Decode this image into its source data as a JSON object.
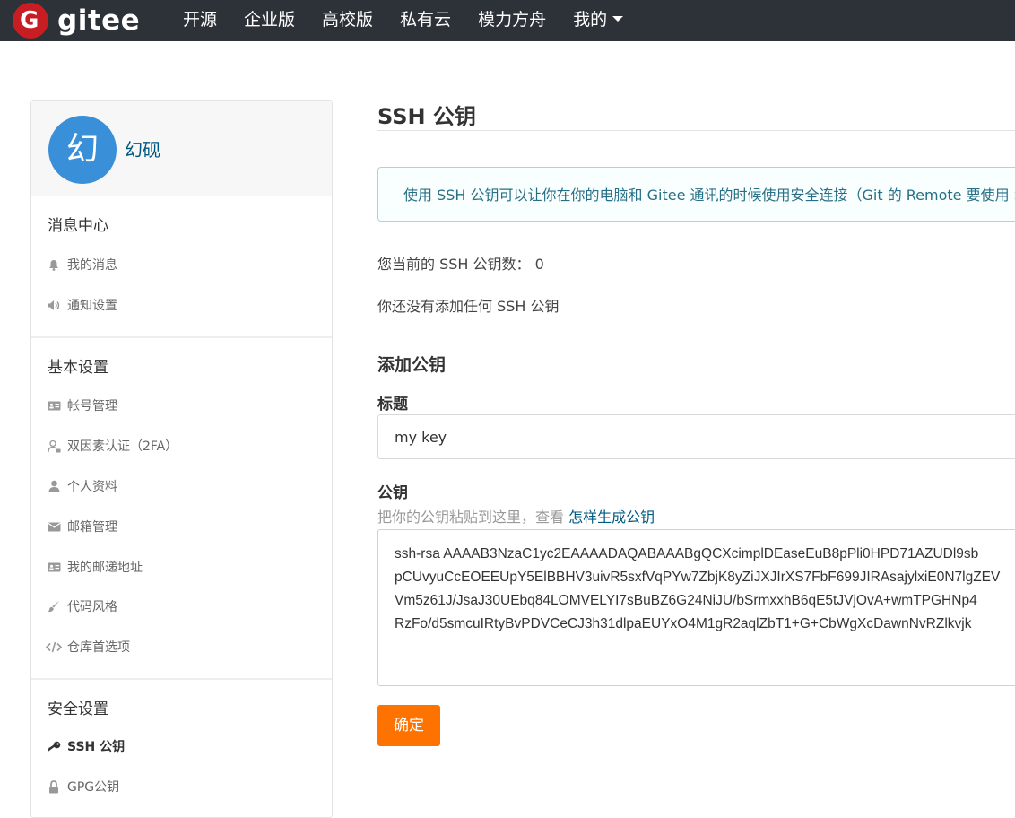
{
  "topbar": {
    "logo_letter": "G",
    "logo_text": "gitee",
    "nav": [
      "开源",
      "企业版",
      "高校版",
      "私有云",
      "模力方舟",
      "我的"
    ]
  },
  "sidebar": {
    "avatar_char": "幻",
    "username": "幻砚",
    "sections": [
      {
        "title": "消息中心",
        "items": [
          {
            "label": "我的消息",
            "icon": "bell-icon"
          },
          {
            "label": "通知设置",
            "icon": "speaker-icon"
          }
        ]
      },
      {
        "title": "基本设置",
        "items": [
          {
            "label": "帐号管理",
            "icon": "id-card-icon"
          },
          {
            "label": "双因素认证（2FA）",
            "icon": "user-lock-icon"
          },
          {
            "label": "个人资料",
            "icon": "user-icon"
          },
          {
            "label": "邮箱管理",
            "icon": "envelope-icon"
          },
          {
            "label": "我的邮递地址",
            "icon": "address-card-icon"
          },
          {
            "label": "代码风格",
            "icon": "brush-icon"
          },
          {
            "label": "仓库首选项",
            "icon": "code-icon"
          }
        ]
      },
      {
        "title": "安全设置",
        "items": [
          {
            "label": "SSH 公钥",
            "icon": "key-icon",
            "active": true
          },
          {
            "label": "GPG公钥",
            "icon": "lock-icon"
          }
        ]
      }
    ]
  },
  "main": {
    "title": "SSH 公钥",
    "info": "使用 SSH 公钥可以让你在你的电脑和 Gitee 通讯的时候使用安全连接（Git 的 Remote 要使用 SSH 地址）",
    "count_text": "您当前的 SSH 公钥数： 0",
    "empty_text": "你还没有添加任何 SSH 公钥",
    "add_heading": "添加公钥",
    "title_label": "标题",
    "title_value": "my key",
    "key_label": "公钥",
    "key_hint": "把你的公钥粘贴到这里，查看 ",
    "key_hint_link": "怎样生成公钥",
    "key_lines": [
      "ssh-rsa AAAAB3NzaC1yc2EAAAADAQABAAABgQCXcimplDEaseEuB8pPli0HPD71AZUDl9sb",
      "pCUvyuCcEOEEUpY5ElBBHV3uivR5sxfVqPYw7ZbjK8yZiJXJIrXS7FbF699JIRAsajylxiE0N7lgZEV",
      "Vm5z61J/JsaJ30UEbq84LOMVELYI7sBuBZ6G24NiJU/bSrmxxhB6qE5tJVjOvA+wmTPGHNp4",
      "RzFo/d5smcuIRtyBvPDVCeCJ3h31dlpaEUYxO4M1gR2aqlZbT1+G+CbWgXcDawnNvRZlkvjk"
    ],
    "submit_label": "确定"
  },
  "colors": {
    "topbar": "#2d3138",
    "brand_red": "#c71d23",
    "link": "#005980",
    "button": "#fe7300",
    "avatar": "#3a8fd9"
  }
}
